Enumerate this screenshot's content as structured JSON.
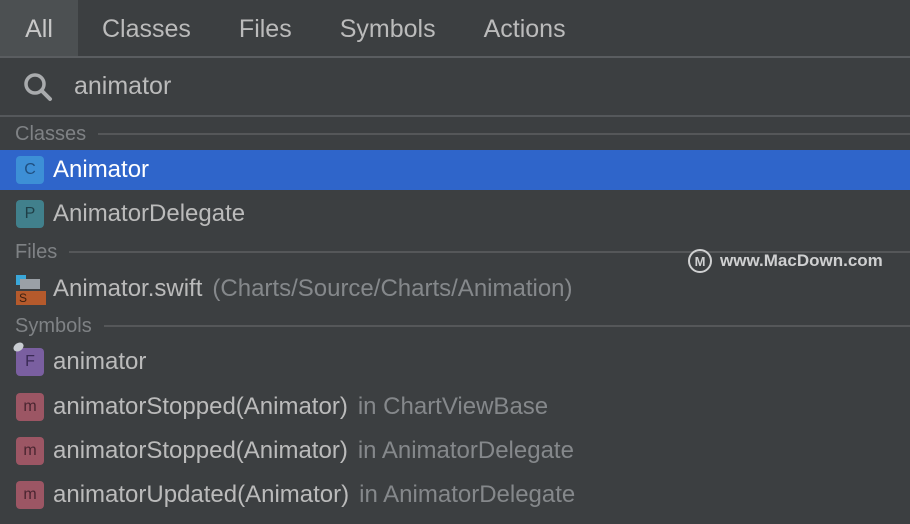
{
  "tabs": [
    "All",
    "Classes",
    "Files",
    "Symbols",
    "Actions"
  ],
  "search": {
    "value": "animator"
  },
  "groups": {
    "classes": "Classes",
    "files": "Files",
    "symbols": "Symbols"
  },
  "classes": [
    {
      "icon": "C",
      "name": "Animator",
      "selected": true
    },
    {
      "icon": "P",
      "name": "AnimatorDelegate"
    }
  ],
  "files": [
    {
      "icon": "S",
      "name": "Animator.swift",
      "path": "(Charts/Source/Charts/Animation)"
    }
  ],
  "symbols": [
    {
      "icon": "F",
      "name": "animator",
      "context": ""
    },
    {
      "icon": "m",
      "name": "animatorStopped(Animator)",
      "context": "in ChartViewBase"
    },
    {
      "icon": "m",
      "name": "animatorStopped(Animator)",
      "context": "in AnimatorDelegate"
    },
    {
      "icon": "m",
      "name": "animatorUpdated(Animator)",
      "context": "in AnimatorDelegate"
    }
  ],
  "watermark": {
    "text": "www.MacDown.com",
    "logo": "M"
  },
  "colors": {
    "selection": "#2f65ca",
    "class": "#3d8fd6",
    "protocol": "#41808c",
    "field": "#7a5fa0",
    "method": "#9c5664",
    "file": "#b55a2c"
  }
}
